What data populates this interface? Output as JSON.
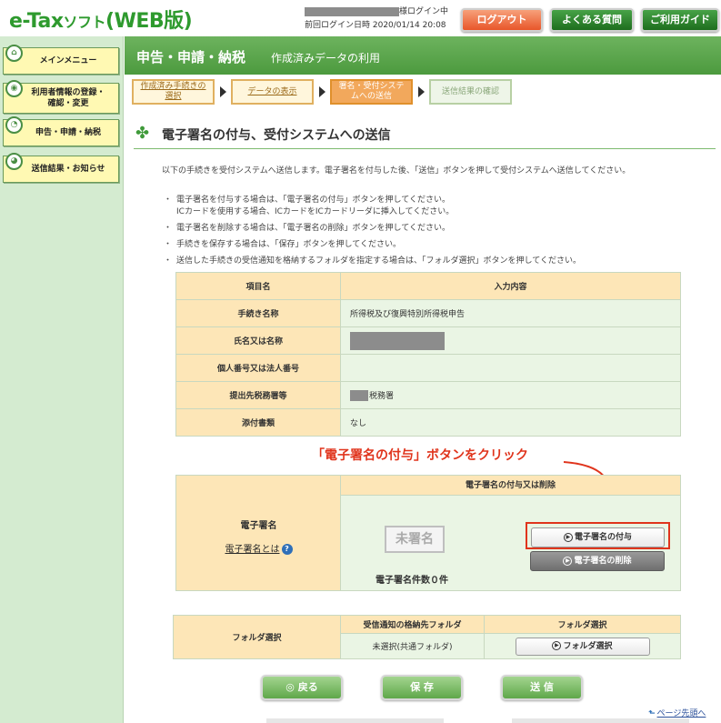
{
  "app": {
    "logo": "e-Taxソフト(WEB版)",
    "logo_main": "e-Tax",
    "logo_soft": "ソフト",
    "logo_web": "(WEB版)"
  },
  "header": {
    "login_suffix": "様ログイン中",
    "last_login": "前回ログイン日時 2020/01/14 20:08",
    "logout": "ログアウト",
    "faq": "よくある質問",
    "guide": "ご利用ガイド"
  },
  "sidebar": {
    "items": [
      {
        "label": "メインメニュー"
      },
      {
        "label_line1": "利用者情報の登録・",
        "label_line2": "確認・変更"
      },
      {
        "label": "申告・申請・納税"
      },
      {
        "label": "送信結果・お知らせ"
      }
    ]
  },
  "titlebar": {
    "section": "申告・申請・納税",
    "sub": "作成済みデータの利用"
  },
  "steps": [
    {
      "line1": "作成済み手続きの",
      "line2": "選択",
      "state": "done"
    },
    {
      "line1": "データの表示",
      "line2": "",
      "state": "done"
    },
    {
      "line1": "署名・受付システ",
      "line2": "ムへの送信",
      "state": "current"
    },
    {
      "line1": "送信結果の確認",
      "line2": "",
      "state": "todo"
    }
  ],
  "heading": "電子署名の付与、受付システムへの送信",
  "intro": "以下の手続きを受付システムへ送信します。電子署名を付与した後、「送信」ボタンを押して受付システムへ送信してください。",
  "notes": [
    {
      "line1": "電子署名を付与する場合は、「電子署名の付与」ボタンを押してください。",
      "line2": "ICカードを使用する場合、ICカードをICカードリーダに挿入してください。"
    },
    {
      "line1": "電子署名を削除する場合は、「電子署名の削除」ボタンを押してください。",
      "line2": ""
    },
    {
      "line1": "手続きを保存する場合は、「保存」ボタンを押してください。",
      "line2": ""
    },
    {
      "line1": "送信した手続きの受信通知を格納するフォルダを指定する場合は、「フォルダ選択」ボタンを押してください。",
      "line2": ""
    }
  ],
  "info_table": {
    "head": [
      "項目名",
      "入力内容"
    ],
    "rows": [
      {
        "key": "手続き名称",
        "value": "所得税及び復興特別所得税申告"
      },
      {
        "key": "氏名又は名称",
        "value": ""
      },
      {
        "key": "個人番号又は法人番号",
        "value": ""
      },
      {
        "key": "提出先税務署等",
        "value": "税務署"
      },
      {
        "key": "添付書類",
        "value": "なし"
      }
    ]
  },
  "annotation": "「電子署名の付与」ボタンをクリック",
  "signature": {
    "label": "電子署名",
    "help_link": "電子署名とは",
    "help_icon": "?",
    "head": "電子署名の付与又は削除",
    "stamp": "未署名",
    "count": "電子署名件数０件",
    "sign_button": "電子署名の付与",
    "delete_button": "電子署名の削除",
    "highlight_color": "#e0341c"
  },
  "folder": {
    "label": "フォルダ選択",
    "col1": "受信通知の格納先フォルダ",
    "col2": "フォルダ選択",
    "value": "未選択(共通フォルダ)",
    "button": "フォルダ選択"
  },
  "buttons": {
    "back": "戻る",
    "save": "保 存",
    "send": "送 信"
  },
  "pagetop": "ページ先頭へ",
  "colors": {
    "brand_green": "#4c9a3e",
    "sidebar_bg": "#d4ebd0",
    "table_key_bg": "#fde6b7",
    "table_val_bg": "#eaf5e4",
    "alert_red": "#e0341c"
  }
}
